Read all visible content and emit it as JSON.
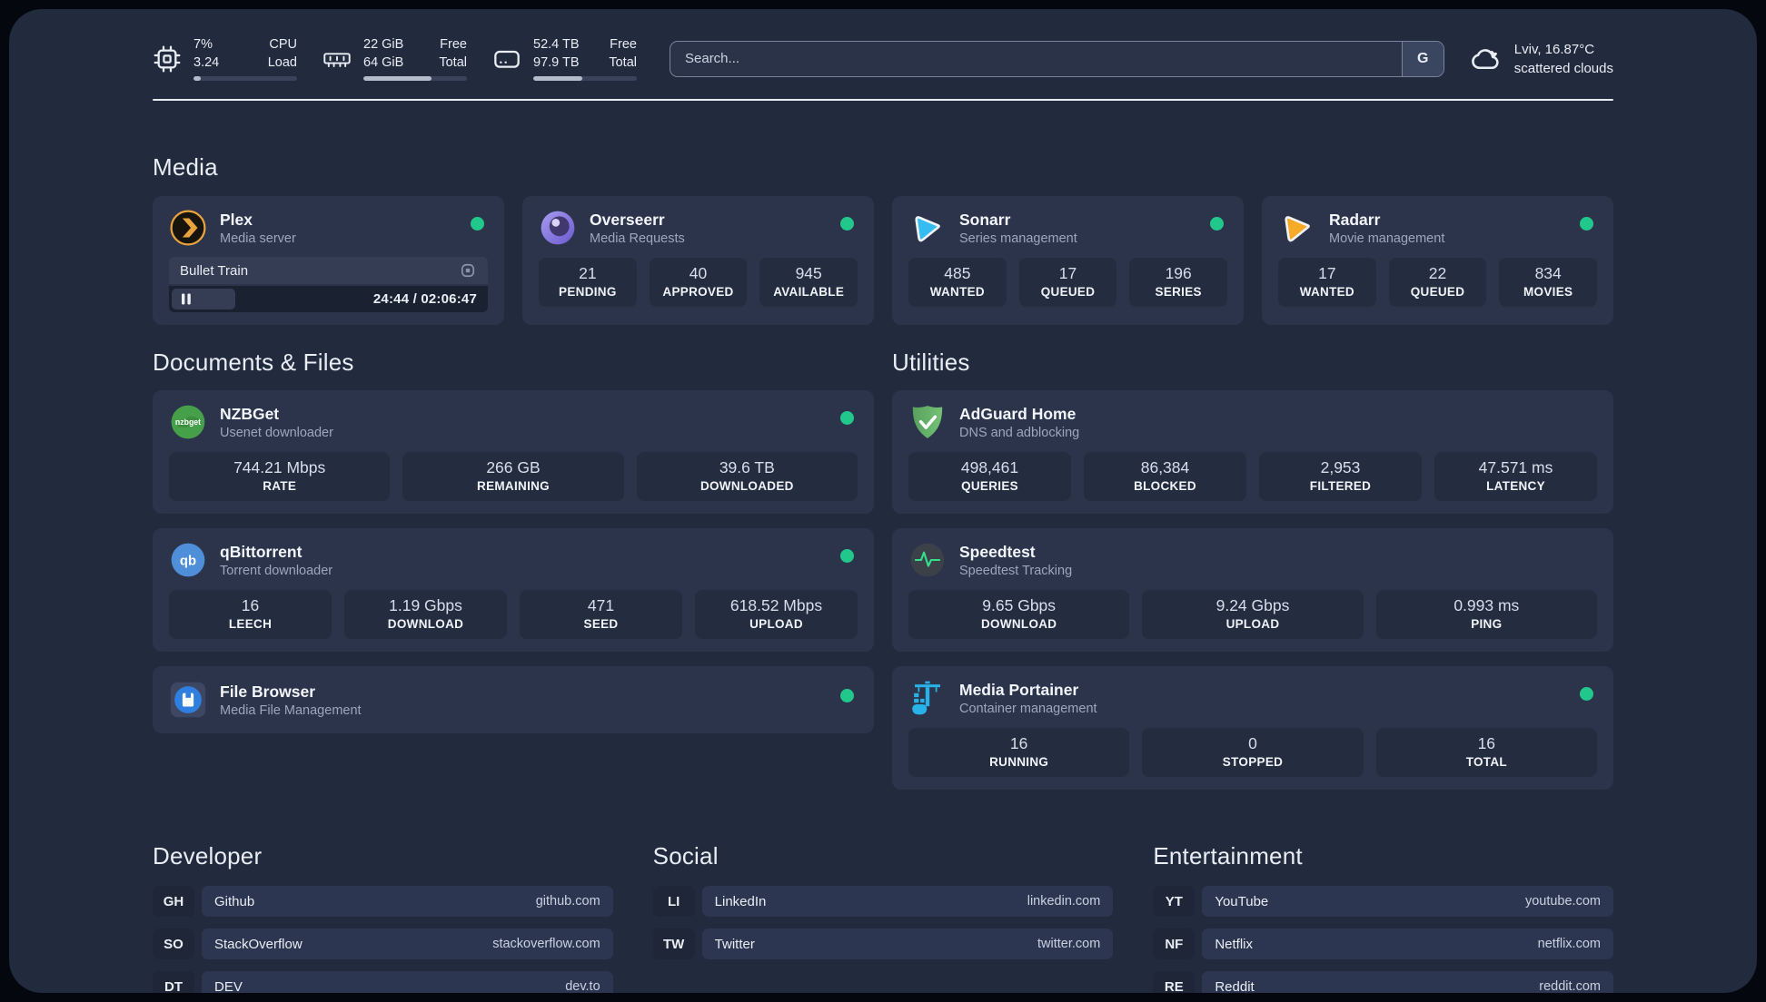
{
  "colors": {
    "surface": "#222a3e",
    "card": "#2b344b",
    "tile": "#242c40",
    "status_online": "#22c78c",
    "plex_gold": "#e8a33d",
    "sonarr_blue": "#35bdf2",
    "radarr_orange": "#f7a928",
    "adguard_green": "#67b168",
    "portainer_cyan": "#29b2e8"
  },
  "header": {
    "cpu": {
      "value1": "7%",
      "value2": "3.24",
      "label1": "CPU",
      "label2": "Load",
      "progress": 7
    },
    "ram": {
      "value1": "22 GiB",
      "value2": "64 GiB",
      "label1": "Free",
      "label2": "Total",
      "progress": 66
    },
    "disk": {
      "value1": "52.4 TB",
      "value2": "97.9 TB",
      "label1": "Free",
      "label2": "Total",
      "progress": 47
    },
    "search": {
      "placeholder": "Search...",
      "provider": "G"
    },
    "weather": {
      "location": "Lviv, 16.87°C",
      "condition": "scattered clouds"
    }
  },
  "media": {
    "title": "Media",
    "plex": {
      "title": "Plex",
      "subtitle": "Media server",
      "now_playing": "Bullet Train",
      "time": "24:44 / 02:06:47",
      "progress": 20
    },
    "overseerr": {
      "title": "Overseerr",
      "subtitle": "Media Requests",
      "stats": [
        {
          "value": "21",
          "label": "PENDING"
        },
        {
          "value": "40",
          "label": "APPROVED"
        },
        {
          "value": "945",
          "label": "AVAILABLE"
        }
      ]
    },
    "sonarr": {
      "title": "Sonarr",
      "subtitle": "Series management",
      "stats": [
        {
          "value": "485",
          "label": "WANTED"
        },
        {
          "value": "17",
          "label": "QUEUED"
        },
        {
          "value": "196",
          "label": "SERIES"
        }
      ]
    },
    "radarr": {
      "title": "Radarr",
      "subtitle": "Movie management",
      "stats": [
        {
          "value": "17",
          "label": "WANTED"
        },
        {
          "value": "22",
          "label": "QUEUED"
        },
        {
          "value": "834",
          "label": "MOVIES"
        }
      ]
    }
  },
  "documents": {
    "title": "Documents & Files",
    "nzbget": {
      "title": "NZBGet",
      "subtitle": "Usenet downloader",
      "icon_text": "nzbget",
      "stats": [
        {
          "value": "744.21 Mbps",
          "label": "RATE"
        },
        {
          "value": "266 GB",
          "label": "REMAINING"
        },
        {
          "value": "39.6 TB",
          "label": "DOWNLOADED"
        }
      ]
    },
    "qbittorrent": {
      "title": "qBittorrent",
      "subtitle": "Torrent downloader",
      "icon_text": "qb",
      "stats": [
        {
          "value": "16",
          "label": "LEECH"
        },
        {
          "value": "1.19 Gbps",
          "label": "DOWNLOAD"
        },
        {
          "value": "471",
          "label": "SEED"
        },
        {
          "value": "618.52 Mbps",
          "label": "UPLOAD"
        }
      ]
    },
    "filebrowser": {
      "title": "File Browser",
      "subtitle": "Media File Management"
    }
  },
  "utilities": {
    "title": "Utilities",
    "adguard": {
      "title": "AdGuard Home",
      "subtitle": "DNS and adblocking",
      "stats": [
        {
          "value": "498,461",
          "label": "QUERIES"
        },
        {
          "value": "86,384",
          "label": "BLOCKED"
        },
        {
          "value": "2,953",
          "label": "FILTERED"
        },
        {
          "value": "47.571 ms",
          "label": "LATENCY"
        }
      ]
    },
    "speedtest": {
      "title": "Speedtest",
      "subtitle": "Speedtest Tracking",
      "stats": [
        {
          "value": "9.65 Gbps",
          "label": "DOWNLOAD"
        },
        {
          "value": "9.24 Gbps",
          "label": "UPLOAD"
        },
        {
          "value": "0.993 ms",
          "label": "PING"
        }
      ]
    },
    "portainer": {
      "title": "Media Portainer",
      "subtitle": "Container management",
      "stats": [
        {
          "value": "16",
          "label": "RUNNING"
        },
        {
          "value": "0",
          "label": "STOPPED"
        },
        {
          "value": "16",
          "label": "TOTAL"
        }
      ]
    }
  },
  "links": {
    "developer": {
      "title": "Developer",
      "items": [
        {
          "badge": "GH",
          "name": "Github",
          "url": "github.com"
        },
        {
          "badge": "SO",
          "name": "StackOverflow",
          "url": "stackoverflow.com"
        },
        {
          "badge": "DT",
          "name": "DEV",
          "url": "dev.to"
        }
      ]
    },
    "social": {
      "title": "Social",
      "items": [
        {
          "badge": "LI",
          "name": "LinkedIn",
          "url": "linkedin.com"
        },
        {
          "badge": "TW",
          "name": "Twitter",
          "url": "twitter.com"
        }
      ]
    },
    "entertainment": {
      "title": "Entertainment",
      "items": [
        {
          "badge": "YT",
          "name": "YouTube",
          "url": "youtube.com"
        },
        {
          "badge": "NF",
          "name": "Netflix",
          "url": "netflix.com"
        },
        {
          "badge": "RE",
          "name": "Reddit",
          "url": "reddit.com"
        }
      ]
    }
  }
}
